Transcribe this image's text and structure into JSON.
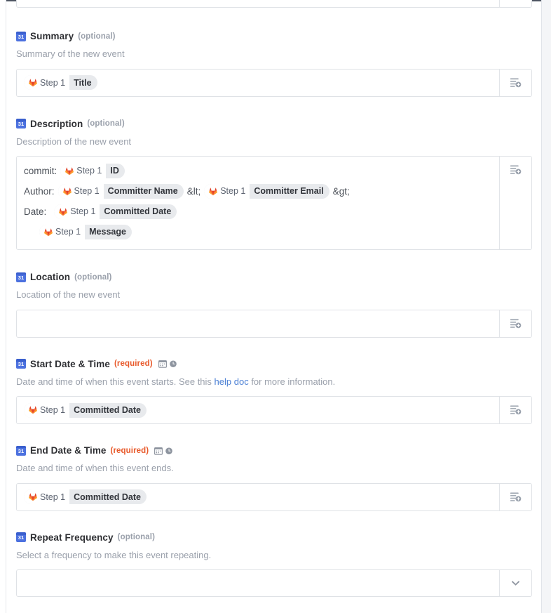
{
  "app": {
    "source_icon": "gitlab-icon",
    "field_icon": "google-calendar-icon",
    "calendar_icon_day": "31",
    "accent_blue": "#4c71df",
    "required_color": "#e8592a",
    "link_color": "#4a7fd4",
    "pill_bg": "#e8eaed"
  },
  "fields": [
    {
      "name": "summary",
      "label": "Summary",
      "qualifier": "(optional)",
      "required": false,
      "description": "Summary of the new event",
      "control": "text",
      "tokens": [
        {
          "source": "Step 1",
          "field": "Title"
        }
      ],
      "action_icon": "insert-field-icon"
    },
    {
      "name": "description",
      "label": "Description",
      "qualifier": "(optional)",
      "required": false,
      "description": "Description of the new event",
      "control": "textarea",
      "lines": [
        {
          "indent": false,
          "parts": [
            {
              "type": "text",
              "value": "commit:"
            },
            {
              "type": "token",
              "source": "Step 1",
              "field": "ID"
            }
          ]
        },
        {
          "indent": false,
          "parts": [
            {
              "type": "text",
              "value": "Author:"
            },
            {
              "type": "token",
              "source": "Step 1",
              "field": "Committer Name"
            },
            {
              "type": "text",
              "value": "&lt;"
            },
            {
              "type": "token",
              "source": "Step 1",
              "field": "Committer Email"
            },
            {
              "type": "text",
              "value": "&gt;"
            }
          ]
        },
        {
          "indent": false,
          "parts": [
            {
              "type": "text",
              "value": "Date:"
            },
            {
              "type": "token",
              "source": "Step 1",
              "field": "Committed Date"
            }
          ]
        },
        {
          "indent": true,
          "parts": [
            {
              "type": "token",
              "source": "Step 1",
              "field": "Message"
            }
          ]
        }
      ],
      "action_icon": "insert-field-icon"
    },
    {
      "name": "location",
      "label": "Location",
      "qualifier": "(optional)",
      "required": false,
      "description": "Location of the new event",
      "control": "text",
      "tokens": [],
      "value": "",
      "action_icon": "insert-field-icon"
    },
    {
      "name": "start-date-time",
      "label": "Start Date & Time",
      "qualifier": "(required)",
      "required": true,
      "type_icons": [
        "calendar-icon",
        "clock-icon"
      ],
      "description_prefix": "Date and time of when this event starts. See this ",
      "description_link": "help doc",
      "description_suffix": " for more information.",
      "control": "text",
      "tokens": [
        {
          "source": "Step 1",
          "field": "Committed Date"
        }
      ],
      "action_icon": "insert-field-icon"
    },
    {
      "name": "end-date-time",
      "label": "End Date & Time",
      "qualifier": "(required)",
      "required": true,
      "type_icons": [
        "calendar-icon",
        "clock-icon"
      ],
      "description": "Date and time of when this event ends.",
      "control": "text",
      "tokens": [
        {
          "source": "Step 1",
          "field": "Committed Date"
        }
      ],
      "action_icon": "insert-field-icon"
    },
    {
      "name": "repeat-frequency",
      "label": "Repeat Frequency",
      "qualifier": "(optional)",
      "required": false,
      "description": "Select a frequency to make this event repeating.",
      "control": "select",
      "selected_value": "",
      "action_icon": "chevron-down-icon"
    }
  ]
}
